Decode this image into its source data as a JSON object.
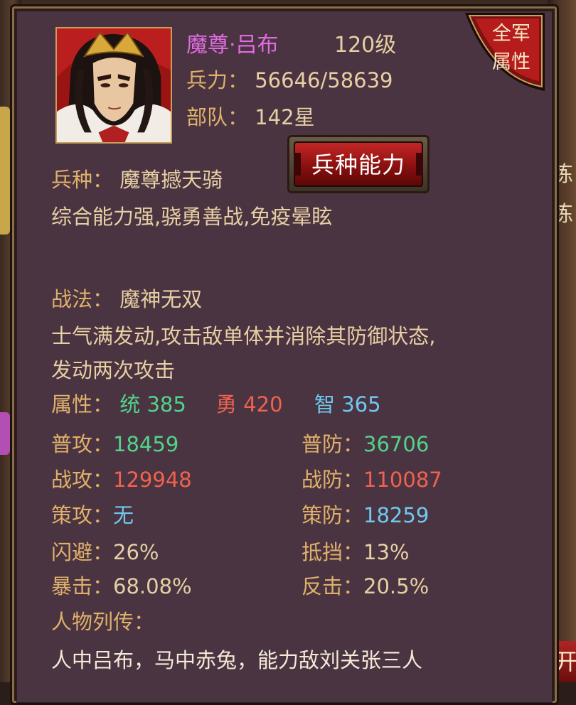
{
  "hero": {
    "name": "魔尊·吕布",
    "level": "120级",
    "troops_label": "兵力：",
    "troops_value": "56646/58639",
    "unit_label": "部队：",
    "unit_value": "142星"
  },
  "corner_badge": {
    "line1": "全军",
    "line2": "属性"
  },
  "troop_button": {
    "label": "兵种能力"
  },
  "troop_type": {
    "label": "兵种：",
    "value": "魔尊撼天骑",
    "desc": "综合能力强,骁勇善战,免疫晕眩"
  },
  "tactic": {
    "label": "战法：",
    "value": "魔神无双",
    "desc_line1": "士气满发动,攻击敌单体并消除其防御状态,",
    "desc_line2": "发动两次攻击"
  },
  "attributes": {
    "label": "属性：",
    "tong": "统 385",
    "yong": "勇 420",
    "zhi": "智 365"
  },
  "stats": {
    "pugong_label": "普攻：",
    "pugong": "18459",
    "pufang_label": "普防：",
    "pufang": "36706",
    "zhangong_label": "战攻：",
    "zhangong": "129948",
    "zhanfang_label": "战防：",
    "zhanfang": "110087",
    "cegong_label": "策攻：",
    "cegong": "无",
    "cefang_label": "策防：",
    "cefang": "18259",
    "shanbi_label": "闪避：",
    "shanbi": "26%",
    "didang_label": "抵挡：",
    "didang": "13%",
    "baoji_label": "暴击：",
    "baoji": "68.08%",
    "fanji_label": "反击：",
    "fanji": "20.5%"
  },
  "bio": {
    "label": "人物列传：",
    "line1": "人中吕布，马中赤兔，能力敌刘关张三人"
  },
  "background": {
    "right_chars": [
      "练",
      "练"
    ],
    "bottom_right": "开"
  },
  "colors": {
    "panel": "#4a3441",
    "gold": "#e0b16b",
    "green": "#52d38a",
    "red": "#f0624f",
    "blue": "#70c8ef",
    "pink": "#e26be2"
  }
}
